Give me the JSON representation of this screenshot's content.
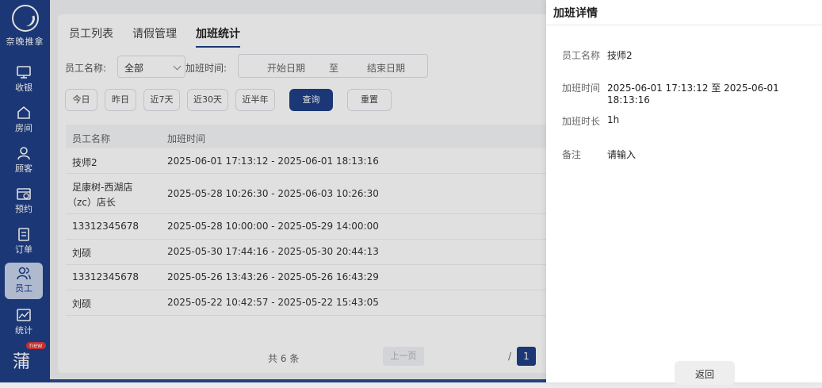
{
  "sidebar": {
    "brand": "奈晚推拿",
    "items": [
      {
        "label": "收银",
        "icon": "monitor-icon"
      },
      {
        "label": "房间",
        "icon": "home-icon"
      },
      {
        "label": "顾客",
        "icon": "user-icon"
      },
      {
        "label": "预约",
        "icon": "calendar-icon"
      },
      {
        "label": "订单",
        "icon": "clipboard-icon"
      },
      {
        "label": "员工",
        "icon": "users-icon",
        "active": true
      },
      {
        "label": "统计",
        "icon": "chart-icon"
      }
    ],
    "new_badge": "new",
    "bottom_char": "蒲"
  },
  "tabs": [
    {
      "label": "员工列表"
    },
    {
      "label": "请假管理"
    },
    {
      "label": "加班统计",
      "active": true
    }
  ],
  "filters": {
    "employee_label": "员工名称:",
    "employee_value": "全部",
    "time_label": "加班时间:",
    "start_placeholder": "开始日期",
    "separator": "至",
    "end_placeholder": "结束日期",
    "quick": [
      "今日",
      "昨日",
      "近7天",
      "近30天",
      "近半年"
    ],
    "query": "查询",
    "reset": "重置"
  },
  "table": {
    "headers": [
      "员工名称",
      "加班时间"
    ],
    "rows": [
      {
        "name": "技师2",
        "time": "2025-06-01 17:13:12 - 2025-06-01 18:13:16"
      },
      {
        "name": "足康树-西湖店",
        "name2": "（zc）店长",
        "time": "2025-05-28 10:26:30 - 2025-06-03 10:26:30"
      },
      {
        "name": "13312345678",
        "time": "2025-05-28 10:00:00 - 2025-05-29 14:00:00"
      },
      {
        "name": "刘硕",
        "time": "2025-05-30 17:44:16 - 2025-05-30 20:44:13"
      },
      {
        "name": "13312345678",
        "time": "2025-05-26 13:43:26 - 2025-05-26 16:43:29"
      },
      {
        "name": "刘硕",
        "time": "2025-05-22 10:42:57 - 2025-05-22 15:43:05"
      }
    ]
  },
  "pagination": {
    "total": "共 6 条",
    "prev": "上一页",
    "slash": "/",
    "current": "1"
  },
  "drawer": {
    "title": "加班详情",
    "fields": [
      {
        "label": "员工名称",
        "value": "技师2"
      },
      {
        "label": "加班时间",
        "value": "2025-06-01 17:13:12 至 2025-06-01 18:13:16"
      },
      {
        "label": "加班时长",
        "value": "1h"
      },
      {
        "label": "备注",
        "value": "请输入"
      }
    ],
    "back": "返回"
  }
}
